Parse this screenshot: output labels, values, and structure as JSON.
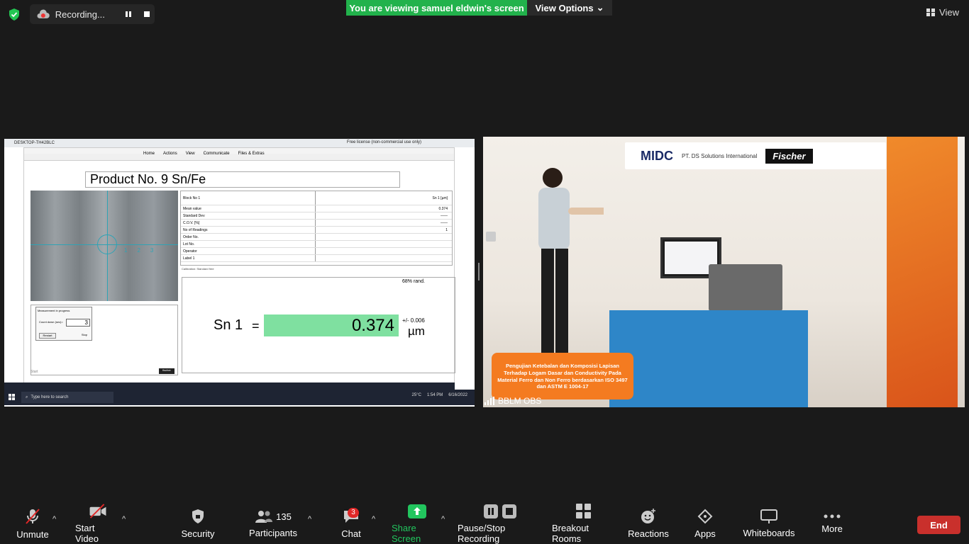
{
  "top": {
    "recording_label": "Recording...",
    "banner": "You are viewing samuel eldwin's screen",
    "view_options": "View Options",
    "view": "View"
  },
  "share": {
    "browser_tab": "DESKTOP-TH42BLC",
    "license": "Free license (non-commercial use only)",
    "nav": [
      "Home",
      "Actions",
      "View",
      "Communicate",
      "Files & Extras"
    ],
    "product_title": "Product No. 9  Sn/Fe",
    "stats_header": {
      "key": "Block No 1",
      "val": "Sn 1 [µm]"
    },
    "stats": [
      {
        "k": "Mean value",
        "v": "0.374"
      },
      {
        "k": "Standard Dev",
        "v": "——"
      },
      {
        "k": "C.O.V. [%]",
        "v": "——"
      },
      {
        "k": "No of Readings",
        "v": "1"
      },
      {
        "k": "Order No.",
        "v": ""
      },
      {
        "k": "Lot No.",
        "v": ""
      },
      {
        "k": "Operator",
        "v": ""
      },
      {
        "k": "Label 1",
        "v": ""
      }
    ],
    "calibration": "Calibration: Standard free",
    "rand": "68% rand.",
    "element": "Sn 1",
    "equals": "=",
    "value": "0.374",
    "plusminus": "+/- 0.006",
    "unit": "µm",
    "dialog_title": "Measurement in progress",
    "countdown_label": "Count down (sec)=",
    "countdown_value": "3",
    "restart": "Restart",
    "stop": "Stop",
    "start": "Start",
    "taskbar_search": "Type here to search",
    "weather": "25°C",
    "time": "1:54 PM",
    "date": "6/16/2022"
  },
  "camera": {
    "logo_midc": "MIDC",
    "logo_ds": "PT. DS Solutions International",
    "logo_fischer": "Fischer",
    "caption": "Pengujian Ketebalan dan Komposisi Lapisan Terhadap Logam Dasar dan Conductivity Pada Material Ferro dan Non Ferro berdasarkan ISO 3497 dan  ASTM E 1004-17",
    "name": "BBLM OBS"
  },
  "controls": {
    "unmute": "Unmute",
    "start_video": "Start Video",
    "security": "Security",
    "participants": "Participants",
    "participants_count": "135",
    "chat": "Chat",
    "chat_badge": "3",
    "share_screen": "Share Screen",
    "pause_stop": "Pause/Stop Recording",
    "breakout": "Breakout Rooms",
    "reactions": "Reactions",
    "apps": "Apps",
    "whiteboards": "Whiteboards",
    "more": "More",
    "end": "End"
  },
  "colors": {
    "accent_green": "#22b24c",
    "end_red": "#c9302c",
    "result_green": "#7fe0a0"
  }
}
